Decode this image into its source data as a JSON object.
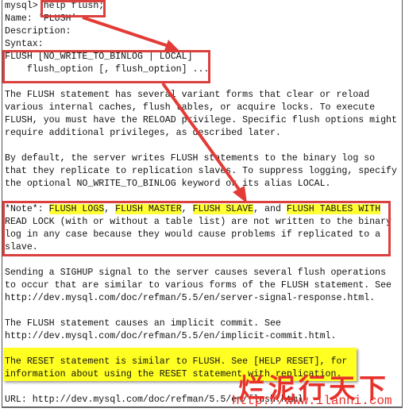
{
  "terminal": {
    "lines": [
      "mysql> help flush;",
      "Name: 'FLUSH'",
      "Description:",
      "Syntax:",
      "FLUSH [NO_WRITE_TO_BINLOG | LOCAL]",
      "    flush_option [, flush_option] ...",
      "",
      "The FLUSH statement has several variant forms that clear or reload",
      "various internal caches, flush tables, or acquire locks. To execute",
      "FLUSH, you must have the RELOAD privilege. Specific flush options might",
      "require additional privileges, as described later.",
      "",
      "By default, the server writes FLUSH statements to the binary log so",
      "that they replicate to replication slaves. To suppress logging, specify",
      "the optional NO_WRITE_TO_BINLOG keyword or its alias LOCAL.",
      "",
      "",
      "READ LOCK (with or without a table list) are not written to the binary",
      "log in any case because they would cause problems if replicated to a",
      "slave.",
      "",
      "Sending a SIGHUP signal to the server causes several flush operations",
      "to occur that are similar to various forms of the FLUSH statement. See",
      "http://dev.mysql.com/doc/refman/5.5/en/server-signal-response.html.",
      "",
      "The FLUSH statement causes an implicit commit. See",
      "http://dev.mysql.com/doc/refman/5.5/en/implicit-commit.html.",
      "",
      "The RESET statement is similar to FLUSH. See [HELP RESET], for",
      "information about using the RESET statement with replication.",
      "",
      "URL: http://dev.mysql.com/doc/refman/5.5/en/flush.html"
    ],
    "note_line": {
      "prefix": "*Note*: ",
      "h1": "FLUSH LOGS",
      "s1": ", ",
      "h2": "FLUSH MASTER",
      "s2": ", ",
      "h3": "FLUSH SLAVE",
      "s3": ", and ",
      "h4": "FLUSH TABLES WITH"
    }
  },
  "annotation_color": "#d9403e",
  "highlight_color": "#ffff33",
  "watermark": {
    "title": "烂泥行天下",
    "url": "http://www.ilanni.com"
  }
}
